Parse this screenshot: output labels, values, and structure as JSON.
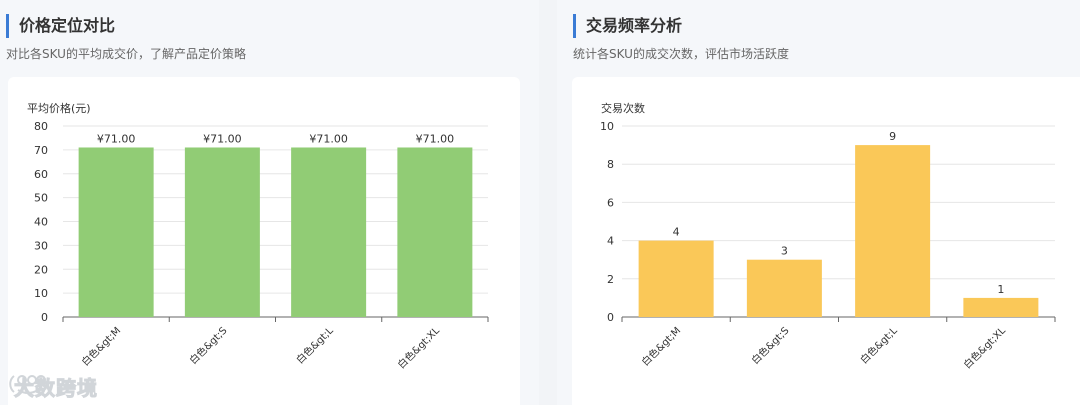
{
  "panels": [
    {
      "title": "价格定位对比",
      "subtitle": "对比各SKU的平均成交价，了解产品定价策略"
    },
    {
      "title": "交易频率分析",
      "subtitle": "统计各SKU的成交次数，评估市场活跃度"
    }
  ],
  "watermark": {
    "text": "大数跨境",
    "icon": "brand-logo-icon"
  },
  "chart_data": [
    {
      "type": "bar",
      "ylabel": "平均价格(元)",
      "categories": [
        "白色&gt;M",
        "白色&gt;S",
        "白色&gt;L",
        "白色&gt;XL"
      ],
      "values": [
        71.0,
        71.0,
        71.0,
        71.0
      ],
      "data_labels": [
        "¥71.00",
        "¥71.00",
        "¥71.00",
        "¥71.00"
      ],
      "ylim": [
        0,
        80
      ],
      "yticks": [
        0,
        10,
        20,
        30,
        40,
        50,
        60,
        70,
        80
      ],
      "color": "#91cc75",
      "grid": true
    },
    {
      "type": "bar",
      "ylabel": "交易次数",
      "categories": [
        "白色&gt;M",
        "白色&gt;S",
        "白色&gt;L",
        "白色&gt;XL"
      ],
      "values": [
        4,
        3,
        9,
        1
      ],
      "data_labels": [
        "4",
        "3",
        "9",
        "1"
      ],
      "ylim": [
        0,
        10
      ],
      "yticks": [
        0,
        2,
        4,
        6,
        8,
        10
      ],
      "color": "#fac858",
      "grid": true
    }
  ]
}
